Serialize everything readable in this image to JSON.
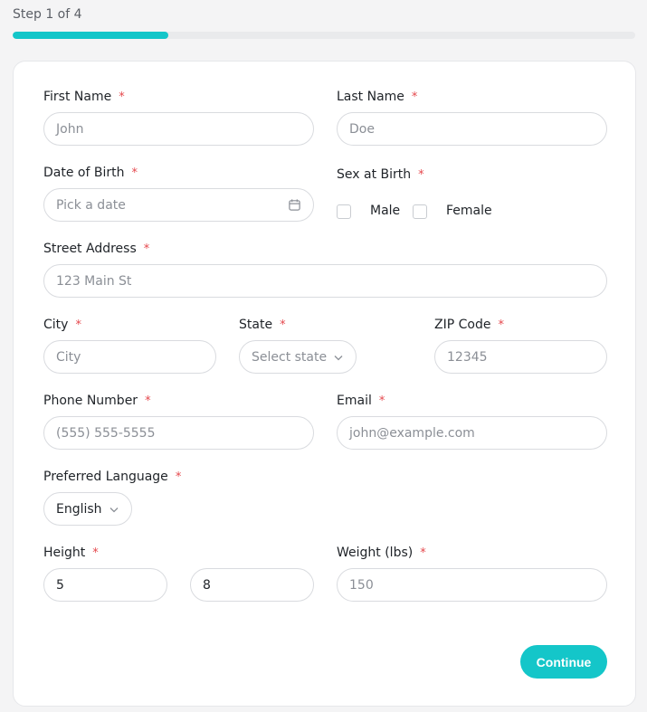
{
  "progress": {
    "step_text": "Step 1 of 4",
    "fraction": 0.25
  },
  "form": {
    "required_marker": "*",
    "first_name": {
      "label": "First Name",
      "placeholder": "John"
    },
    "last_name": {
      "label": "Last Name",
      "placeholder": "Doe"
    },
    "dob": {
      "label": "Date of Birth",
      "placeholder": "Pick a date",
      "icon": "calendar-icon"
    },
    "sex": {
      "label": "Sex at Birth",
      "options": [
        "Male",
        "Female"
      ]
    },
    "street": {
      "label": "Street Address",
      "placeholder": "123 Main St"
    },
    "city": {
      "label": "City",
      "placeholder": "City"
    },
    "state": {
      "label": "State",
      "placeholder": "Select state",
      "icon": "chevron-down-icon"
    },
    "zip": {
      "label": "ZIP Code",
      "placeholder": "12345"
    },
    "phone": {
      "label": "Phone Number",
      "placeholder": "(555) 555-5555"
    },
    "email": {
      "label": "Email",
      "placeholder": "john@example.com"
    },
    "language": {
      "label": "Preferred Language",
      "value": "English",
      "icon": "chevron-down-icon"
    },
    "height": {
      "label": "Height",
      "feet": "5",
      "inches": "8"
    },
    "weight": {
      "label": "Weight (lbs)",
      "placeholder": "150"
    }
  },
  "actions": {
    "continue_label": "Continue"
  },
  "colors": {
    "accent": "#14c6c9",
    "required": "#e5484d"
  }
}
